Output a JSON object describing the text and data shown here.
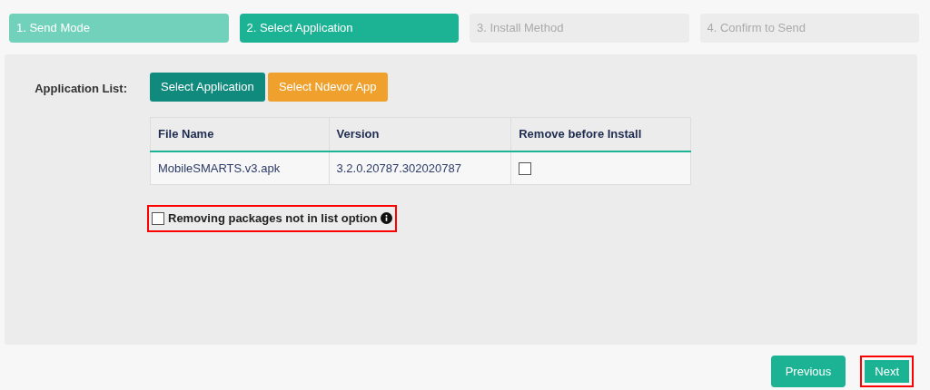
{
  "steps": [
    {
      "label": "1. Send Mode",
      "kind": "done"
    },
    {
      "label": "2. Select Application",
      "kind": "active"
    },
    {
      "label": "3. Install Method",
      "kind": "pending"
    },
    {
      "label": "4. Confirm to Send",
      "kind": "pending"
    }
  ],
  "application_list": {
    "label": "Application List:",
    "buttons": [
      {
        "label": "Select Application",
        "kind": "primary"
      },
      {
        "label": "Select Ndevor App",
        "kind": "warning"
      }
    ],
    "table": {
      "columns": [
        "File Name",
        "Version",
        "Remove before Install"
      ],
      "rows": [
        {
          "file_name": "MobileSMARTS.v3.apk",
          "version": "3.2.0.20787.302020787",
          "remove_before_install": false
        }
      ]
    }
  },
  "remove_option": {
    "label": "Removing packages not in list option",
    "checked": false,
    "highlighted": true
  },
  "nav_buttons": [
    {
      "label": "Previous",
      "highlighted": false
    },
    {
      "label": "Next",
      "highlighted": true
    }
  ]
}
